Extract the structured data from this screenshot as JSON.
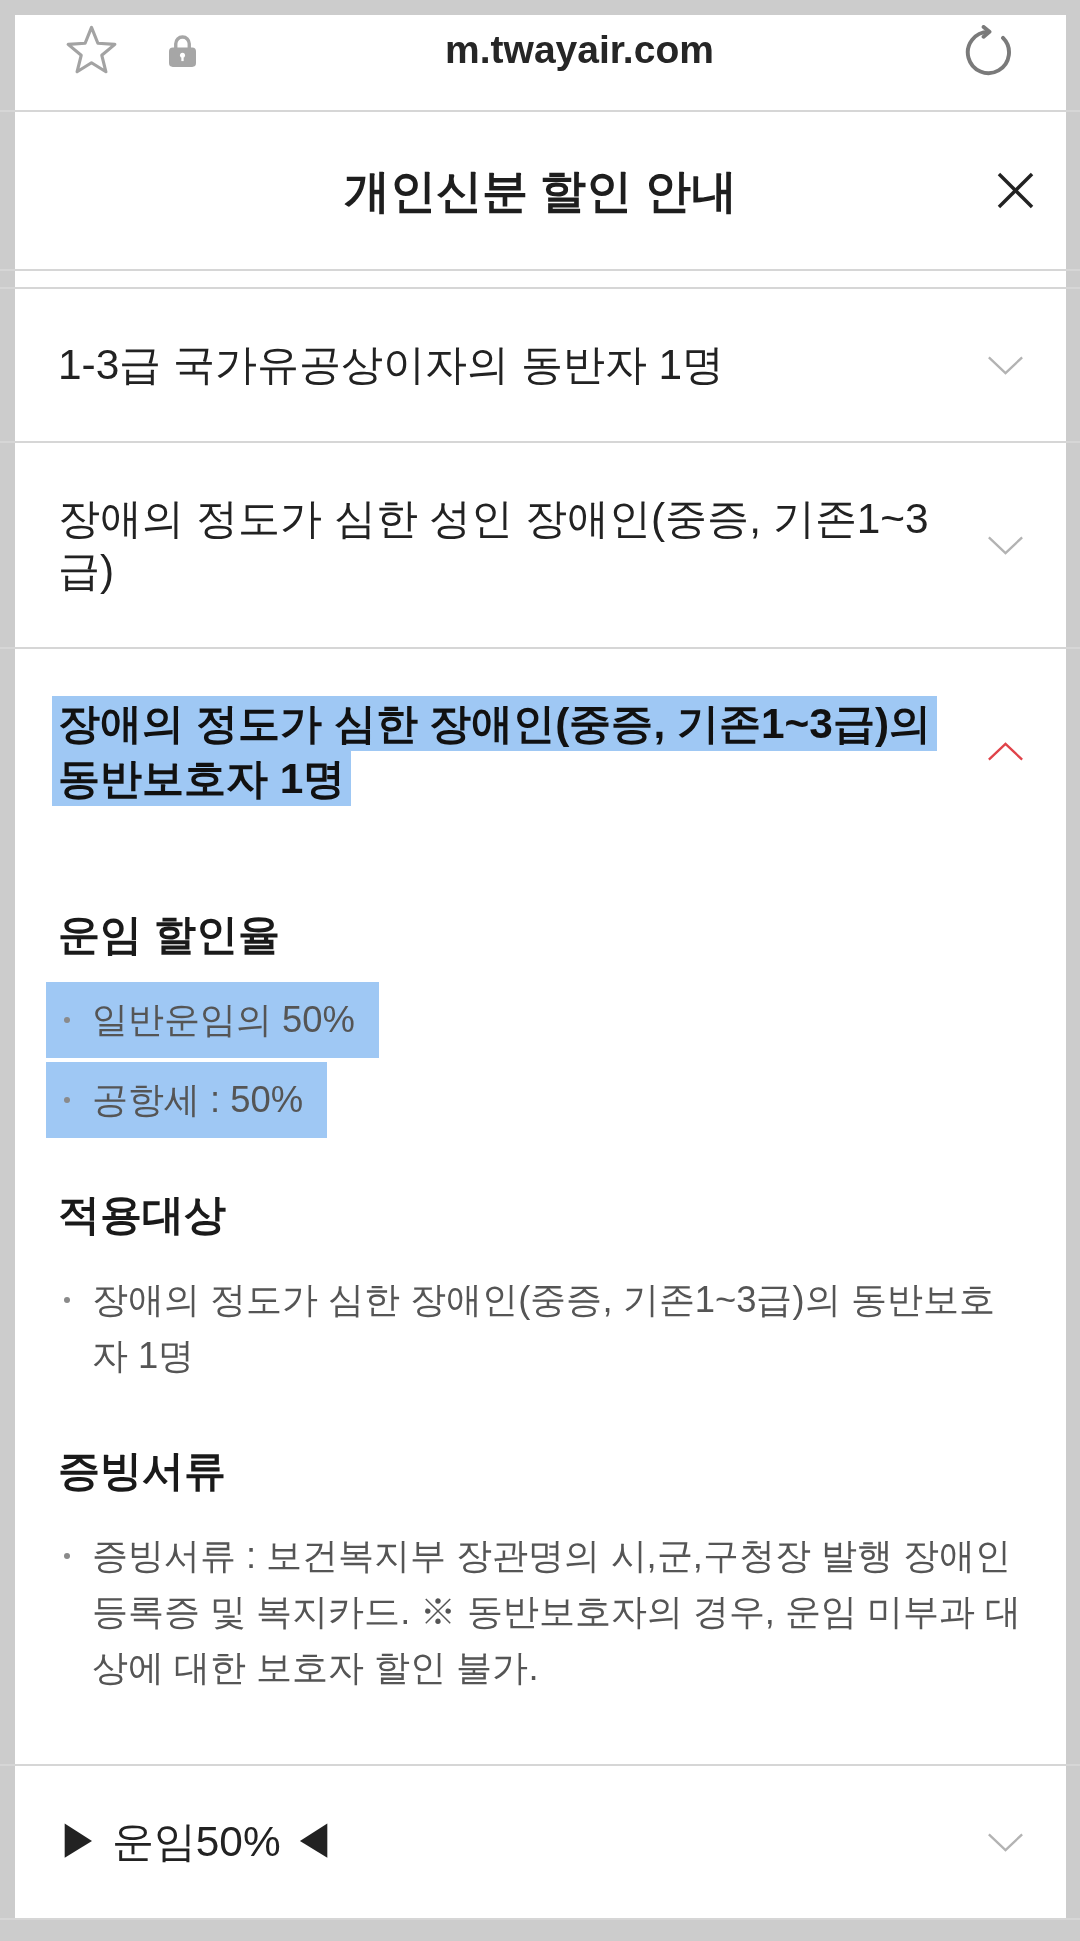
{
  "browser_bar": {
    "url": "m.twayair.com"
  },
  "modal": {
    "title": "개인신분 할인 안내"
  },
  "accordion": [
    {
      "title": "1-3급 국가유공상이자의 동반자 1명",
      "expanded": false,
      "highlighted": false
    },
    {
      "title": "장애의 정도가 심한 성인 장애인(중증, 기존1~3급)",
      "expanded": false,
      "highlighted": false
    },
    {
      "title": "장애의 정도가 심한 장애인(중증, 기존1~3급)의 동반보호자 1명",
      "expanded": true,
      "highlighted": true,
      "sections": [
        {
          "heading": "운임 할인율",
          "bullets": [
            {
              "text": "일반운임의 50%",
              "highlighted": true
            },
            {
              "text": "공항세 : 50%",
              "highlighted": true
            }
          ]
        },
        {
          "heading": "적용대상",
          "bullets": [
            {
              "text": "장애의 정도가 심한 장애인(중증, 기존1~3급)의 동반보호자 1명",
              "highlighted": false
            }
          ]
        },
        {
          "heading": "증빙서류",
          "bullets": [
            {
              "text": "증빙서류 : 보건복지부 장관명의 시,군,구청장 발행 장애인 등록증 및 복지카드. ※ 동반보호자의 경우, 운임 미부과 대상에 대한 보호자 할인 불가.",
              "highlighted": false
            }
          ]
        }
      ]
    },
    {
      "title": "▶ 운임50% ◀",
      "expanded": false,
      "highlighted": false
    }
  ]
}
